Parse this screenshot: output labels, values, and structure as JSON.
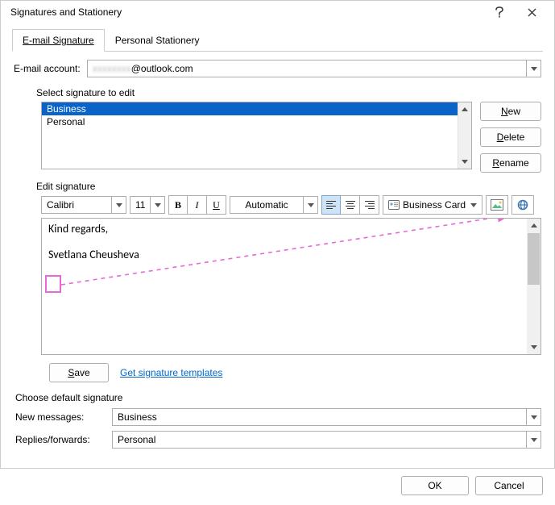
{
  "window": {
    "title": "Signatures and Stationery"
  },
  "tabs": {
    "email_sig": "E-mail Signature",
    "personal_stationery": "Personal Stationery"
  },
  "account": {
    "label_prefix": "E",
    "label_suffix": "-mail account:",
    "domain": "@outlook.com"
  },
  "select_sig": {
    "label": "Select signature to edit",
    "items": [
      "Business",
      "Personal"
    ],
    "selected_index": 0,
    "buttons": {
      "new": "New",
      "delete": "Delete",
      "rename": "Rename"
    }
  },
  "edit_sig": {
    "label": "Edit signature",
    "font": "Calibri",
    "size": "11",
    "color_label": "Automatic",
    "bizcard": "Business Card",
    "content_line1": "Kind regards,",
    "content_line2": "Svetlana Cheusheva",
    "save": "Save",
    "templates_link": "Get signature templates"
  },
  "defaults": {
    "header": "Choose default signature",
    "new_msgs_label_prefix": "New ",
    "new_msgs_label_u": "m",
    "new_msgs_label_suffix": "essages:",
    "new_msgs_value": "Business",
    "replies_label": "Replies/forwards:",
    "replies_value": "Personal"
  },
  "footer": {
    "ok": "OK",
    "cancel": "Cancel"
  }
}
